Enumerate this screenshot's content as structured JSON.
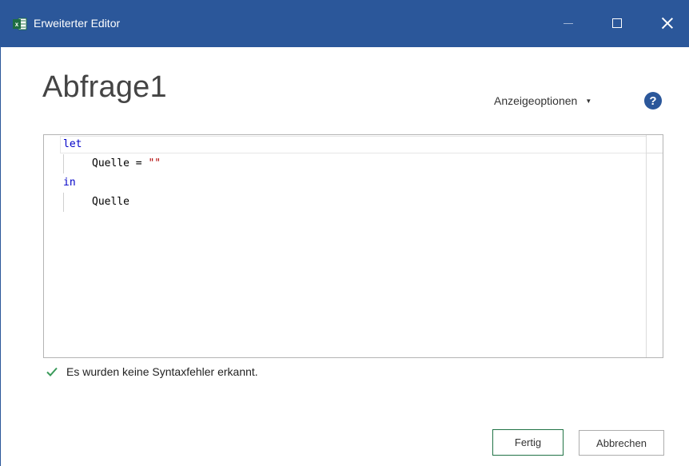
{
  "window": {
    "title": "Erweiterter Editor",
    "app_icon_letter": "x",
    "accent_color": "#2b579a"
  },
  "header": {
    "query_name": "Abfrage1",
    "view_options_label": "Anzeigeoptionen",
    "help_label": "?"
  },
  "editor": {
    "lines": [
      {
        "keyword": "let"
      },
      {
        "identifier": "Quelle",
        "operator": " = ",
        "string": "\"\""
      },
      {
        "keyword": "in"
      },
      {
        "identifier": "Quelle"
      }
    ],
    "keyword_color": "#0000c8",
    "string_color": "#b00000"
  },
  "status": {
    "message": "Es wurden keine Syntaxfehler erkannt.",
    "icon": "checkmark-icon",
    "color": "#3a9a5a"
  },
  "footer": {
    "done_label": "Fertig",
    "cancel_label": "Abbrechen"
  }
}
